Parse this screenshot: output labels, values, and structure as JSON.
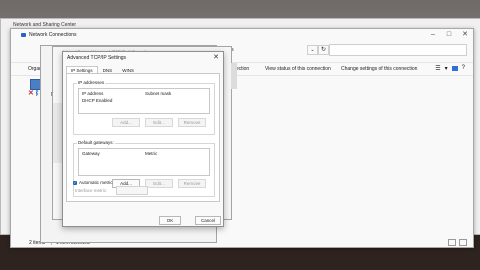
{
  "back_window": {
    "title": "Network and Sharing Center"
  },
  "main_window": {
    "title": "Network Connections",
    "address_tail": "nections",
    "address_dropdown": "⌄",
    "refresh_glyph": "↻",
    "controls": {
      "minimize": "–",
      "maximize": "□",
      "close": "✕"
    },
    "commands": {
      "organize": "Organi",
      "connection": "connection",
      "view_status": "View status of this connection",
      "change_settings": "Change settings of this connection"
    },
    "view_glyph": "☰",
    "view_dropdown": "▾",
    "status": {
      "items": "2 items",
      "selected": "1 item selected"
    }
  },
  "eth_dialog": {
    "tab_partial": "Ne"
  },
  "ipv4_dialog": {
    "title_partial": "Internet Protocol Version 4 (TCP/IPv4) Properties"
  },
  "advanced_dialog": {
    "title": "Advanced TCP/IP Settings",
    "close_glyph": "✕",
    "tabs": [
      "IP Settings",
      "DNS",
      "WINS"
    ],
    "ip_addresses": {
      "label": "IP addresses",
      "columns": [
        "IP address",
        "Subnet mask"
      ],
      "rows": [
        "DHCP Enabled"
      ],
      "buttons": {
        "add": "Add...",
        "edit": "Edit...",
        "remove": "Remove"
      }
    },
    "default_gateways": {
      "label": "Default gateways:",
      "columns": [
        "Gateway",
        "Metric"
      ],
      "buttons": {
        "add": "Add...",
        "edit": "Edit...",
        "remove": "Remove"
      }
    },
    "automatic_metric": {
      "label": "Automatic metric",
      "checked": true,
      "check_glyph": "✓"
    },
    "interface_metric": {
      "label": "Interface metric:"
    },
    "ok": "OK",
    "cancel": "Cancel"
  },
  "icons": {
    "net_adapter": "network-adapter-icon",
    "disconnected": "red-x-icon",
    "bluetooth": "bluetooth-icon"
  }
}
